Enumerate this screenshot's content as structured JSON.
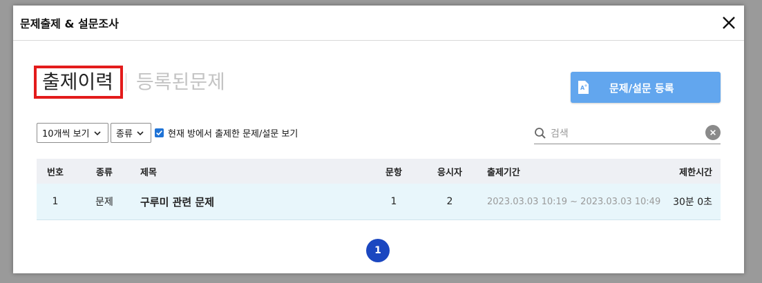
{
  "dialog": {
    "title": "문제출제 & 설문조사",
    "close_icon": "close-icon"
  },
  "tabs": [
    {
      "label": "출제이력",
      "active": true
    },
    {
      "label": "등록된문제",
      "active": false
    }
  ],
  "register_button": {
    "label": "문제/설문 등록",
    "icon": "document-icon"
  },
  "filters": {
    "page_size": "10개씩 보기",
    "type": "종류",
    "checkbox_checked": true,
    "checkbox_label": "현재 방에서 출제한 문제/설문 보기"
  },
  "search": {
    "placeholder": "검색",
    "icon": "search-icon",
    "clear_icon": "clear-icon"
  },
  "table": {
    "columns": [
      "번호",
      "종류",
      "제목",
      "문항",
      "응시자",
      "출제기간",
      "제한시간"
    ],
    "rows": [
      {
        "num": "1",
        "kind": "문제",
        "title": "구루미 관련 문제",
        "questions": "1",
        "participants": "2",
        "period": "2023.03.03 10:19 ~ 2023.03.03 10:49",
        "limit": "30분 0초"
      }
    ]
  },
  "pagination": {
    "current": "1"
  },
  "colors": {
    "accent": "#62a6ee",
    "highlight_box": "#e31b1b",
    "pager": "#1b47c0",
    "row_bg": "#e8f6fb"
  }
}
